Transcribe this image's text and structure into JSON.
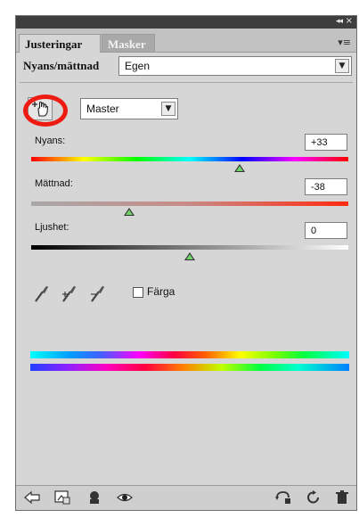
{
  "panel": {
    "tabs": [
      {
        "label": "Justeringar",
        "active": true
      },
      {
        "label": "Masker",
        "active": false
      }
    ],
    "titlebar_collapse": "◂◂",
    "titlebar_close": "×"
  },
  "preset": {
    "label": "Nyans/mättnad",
    "value": "Egen"
  },
  "channel": {
    "value": "Master"
  },
  "sliders": [
    {
      "label": "Nyans:",
      "value": "+33",
      "thumb_fraction": 0.67
    },
    {
      "label": "Mättnad:",
      "value": "-38",
      "thumb_fraction": 0.31
    },
    {
      "label": "Ljushet:",
      "value": "0",
      "thumb_fraction": 0.5
    }
  ],
  "colorize": {
    "label": "Färga",
    "checked": false
  },
  "annotation_color": "#ee1b12",
  "icons": {
    "hand": "targeted-adjustment-icon",
    "droppers": [
      "eyedropper-icon",
      "eyedropper-plus-icon",
      "eyedropper-minus-icon"
    ],
    "bottom_left": [
      "back-arrow-icon",
      "clip-layer-icon",
      "visibility-icon",
      "eye-icon"
    ],
    "bottom_right": [
      "previous-state-icon",
      "reset-icon",
      "trash-icon"
    ]
  }
}
